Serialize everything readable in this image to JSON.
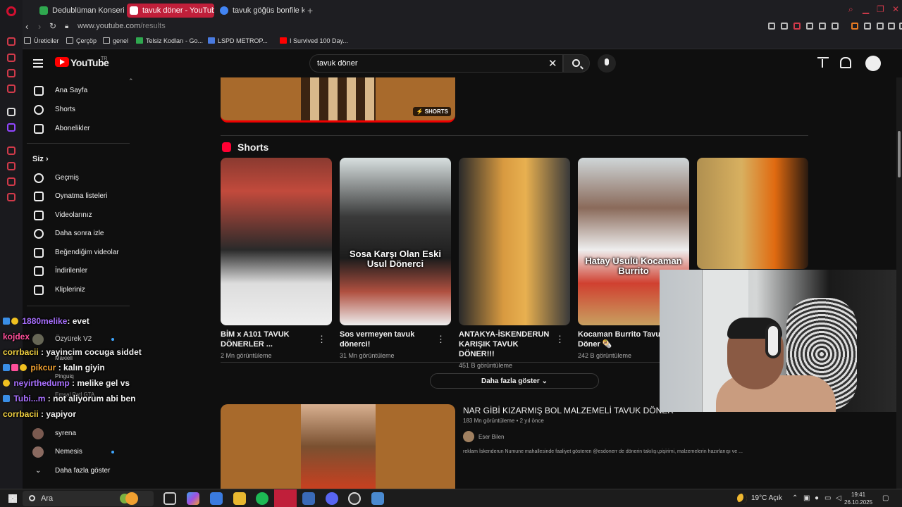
{
  "browser": {
    "tabs": [
      {
        "label": "Dedublüman Konseri Gaz",
        "color": "#2fa84f"
      },
      {
        "label": "tavuk döner - YouTube",
        "color": "#ff0000"
      },
      {
        "label": "tavuk göğüs bonfile kilo f",
        "color": "#4285f4"
      }
    ],
    "new_tab": "+",
    "url_domain": "www.youtube.com",
    "url_path": "/results",
    "bookmarks": [
      "Üreticiler",
      "Çerçöp",
      "genel",
      "Telsiz Kodları - Go...",
      "LSPD METROP...",
      "I Survived 100 Day..."
    ]
  },
  "header": {
    "logo_text": "YouTube",
    "logo_sup": "TR",
    "search_value": "tavuk döner"
  },
  "guide": {
    "main": [
      "Ana Sayfa",
      "Shorts",
      "Abonelikler"
    ],
    "you_title": "Siz",
    "you_items": [
      "Geçmiş",
      "Oynatma listeleri",
      "Videolarınız",
      "Daha sonra izle",
      "Beğendiğim videolar",
      "İndirilenler",
      "Klipleriniz"
    ],
    "subscriptions": [
      "Özyürek V2",
      "Maxiell",
      "Pinguiq",
      "Emsal Patl GTA",
      "syrena",
      "Nemesis"
    ],
    "show_more": "Daha fazla göster"
  },
  "chat": [
    {
      "user": "1880melike",
      "text": "evet",
      "color": "#a970ff"
    },
    {
      "user": "kojdex",
      "text": "",
      "color": "#ff4f9a"
    },
    {
      "user": "corrbacii",
      "text": "yayincim cocuga siddet",
      "color": "#f0d040"
    },
    {
      "user": "pikcur",
      "text": "kalın giyin",
      "color": "#f0a030"
    },
    {
      "user": "neyirthedump",
      "text": "melike gel vs",
      "color": "#a970ff"
    },
    {
      "user": "Tubi...m",
      "text": "not aliyorum abi ben",
      "color": "#a970ff"
    },
    {
      "user": "corrbacii",
      "text": "yapiyor",
      "color": "#f0d040"
    }
  ],
  "results": {
    "prev_short_tag": "SHORTS",
    "shorts_title": "Shorts",
    "shorts": [
      {
        "title": "BİM x A101 TAVUK DÖNERLER ...",
        "views": "2 Mn görüntüleme",
        "caption": ""
      },
      {
        "title": "Sos vermeyen tavuk dönerci!",
        "views": "31 Mn görüntüleme",
        "caption": "Sosa Karşı Olan Eski Usul Dönerci"
      },
      {
        "title": "ANTAKYA-İSKENDERUN KARIŞIK TAVUK DÖNER!!!",
        "views": "451 B görüntüleme",
        "caption": ""
      },
      {
        "title": "Kocaman Burrito Tavuk Döner 🌯",
        "views": "242 B görüntüleme",
        "caption": "Hatay Usulü Kocaman Burrito"
      },
      {
        "title": "",
        "views": "",
        "caption": ""
      }
    ],
    "show_more": "Daha fazla göster",
    "video": {
      "title": "NAR GİBİ KIZARMIŞ BOL MALZEMELİ TAVUK DÖNER...",
      "meta": "183 Mn görüntüleme • 2 yıl önce",
      "channel": "Eser Bilen",
      "desc": "reklam İskenderun Numune mahallesinde faaliyet gösteren @esdonerr de dönerin takılışı,pişirimi, malzemelerin hazırlanışı ve ..."
    }
  },
  "taskbar": {
    "search": "Ara",
    "weather": "19°C  Açık",
    "time": "19:41",
    "date": "26.10.2025"
  }
}
